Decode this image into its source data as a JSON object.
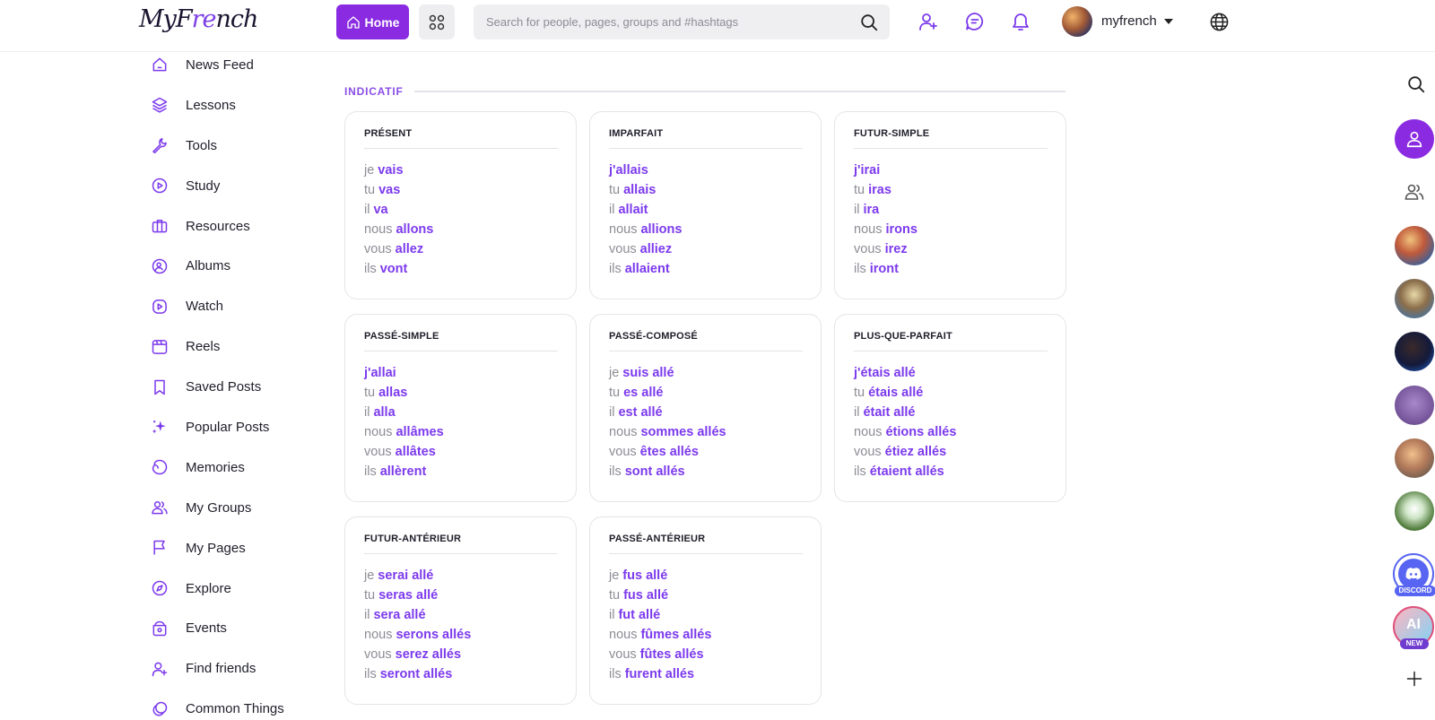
{
  "brand": {
    "logo_prefix": "My",
    "logo_mid": "F",
    "logo_accent": "re",
    "logo_suffix": "nch"
  },
  "colors": {
    "accent": "#8a2be2",
    "verb": "#7c3aed",
    "section": "#8a4ee6",
    "discord": "#5865f2"
  },
  "topbar": {
    "home_label": "Home",
    "search_placeholder": "Search for people, pages, groups and #hashtags",
    "username": "myfrench",
    "icons": [
      "apps-icon",
      "search-icon",
      "add-friend-icon",
      "messages-icon",
      "notifications-icon",
      "globe-icon"
    ]
  },
  "sidebar": {
    "items": [
      {
        "label": "News Feed",
        "icon": "home-icon"
      },
      {
        "label": "Lessons",
        "icon": "layers-icon"
      },
      {
        "label": "Tools",
        "icon": "wrench-icon"
      },
      {
        "label": "Study",
        "icon": "play-circle-icon"
      },
      {
        "label": "Resources",
        "icon": "briefcase-icon"
      },
      {
        "label": "Albums",
        "icon": "album-icon"
      },
      {
        "label": "Watch",
        "icon": "watch-icon"
      },
      {
        "label": "Reels",
        "icon": "reels-icon"
      },
      {
        "label": "Saved Posts",
        "icon": "bookmark-icon"
      },
      {
        "label": "Popular Posts",
        "icon": "sparkle-icon"
      },
      {
        "label": "Memories",
        "icon": "memories-icon"
      },
      {
        "label": "My Groups",
        "icon": "groups-icon"
      },
      {
        "label": "My Pages",
        "icon": "flag-icon"
      },
      {
        "label": "Explore",
        "icon": "compass-icon"
      },
      {
        "label": "Events",
        "icon": "events-icon"
      },
      {
        "label": "Find friends",
        "icon": "find-friends-icon"
      },
      {
        "label": "Common Things",
        "icon": "common-things-icon"
      }
    ]
  },
  "main": {
    "section_title": "INDICATIF",
    "tenses": [
      {
        "title": "PRÉSENT",
        "lines": [
          [
            "je",
            "vais"
          ],
          [
            "tu",
            "vas"
          ],
          [
            "il",
            "va"
          ],
          [
            "nous",
            "allons"
          ],
          [
            "vous",
            "allez"
          ],
          [
            "ils",
            "vont"
          ]
        ]
      },
      {
        "title": "IMPARFAIT",
        "lines": [
          [
            "",
            "j'allais"
          ],
          [
            "tu",
            "allais"
          ],
          [
            "il",
            "allait"
          ],
          [
            "nous",
            "allions"
          ],
          [
            "vous",
            "alliez"
          ],
          [
            "ils",
            "allaient"
          ]
        ]
      },
      {
        "title": "FUTUR-SIMPLE",
        "lines": [
          [
            "",
            "j'irai"
          ],
          [
            "tu",
            "iras"
          ],
          [
            "il",
            "ira"
          ],
          [
            "nous",
            "irons"
          ],
          [
            "vous",
            "irez"
          ],
          [
            "ils",
            "iront"
          ]
        ]
      },
      {
        "title": "PASSÉ-SIMPLE",
        "lines": [
          [
            "",
            "j'allai"
          ],
          [
            "tu",
            "allas"
          ],
          [
            "il",
            "alla"
          ],
          [
            "nous",
            "allâmes"
          ],
          [
            "vous",
            "allâtes"
          ],
          [
            "ils",
            "allèrent"
          ]
        ]
      },
      {
        "title": "PASSÉ-COMPOSÉ",
        "lines": [
          [
            "je",
            "suis allé"
          ],
          [
            "tu",
            "es allé"
          ],
          [
            "il",
            "est allé"
          ],
          [
            "nous",
            "sommes allés"
          ],
          [
            "vous",
            "êtes allés"
          ],
          [
            "ils",
            "sont allés"
          ]
        ]
      },
      {
        "title": "PLUS-QUE-PARFAIT",
        "lines": [
          [
            "",
            "j'étais allé"
          ],
          [
            "tu",
            "étais allé"
          ],
          [
            "il",
            "était allé"
          ],
          [
            "nous",
            "étions allés"
          ],
          [
            "vous",
            "étiez allés"
          ],
          [
            "ils",
            "étaient allés"
          ]
        ]
      },
      {
        "title": "FUTUR-ANTÉRIEUR",
        "lines": [
          [
            "je",
            "serai allé"
          ],
          [
            "tu",
            "seras allé"
          ],
          [
            "il",
            "sera allé"
          ],
          [
            "nous",
            "serons allés"
          ],
          [
            "vous",
            "serez allés"
          ],
          [
            "ils",
            "seront allés"
          ]
        ]
      },
      {
        "title": "PASSÉ-ANTÉRIEUR",
        "lines": [
          [
            "je",
            "fus allé"
          ],
          [
            "tu",
            "fus allé"
          ],
          [
            "il",
            "fut allé"
          ],
          [
            "nous",
            "fûmes allés"
          ],
          [
            "vous",
            "fûtes allés"
          ],
          [
            "ils",
            "furent allés"
          ]
        ]
      }
    ]
  },
  "rail": {
    "discord_tag": "DISCORD",
    "ai_text": "AI",
    "ai_tag": "NEW",
    "icons": [
      "search-icon",
      "profile-icon",
      "friends-icon",
      "add-icon"
    ]
  }
}
